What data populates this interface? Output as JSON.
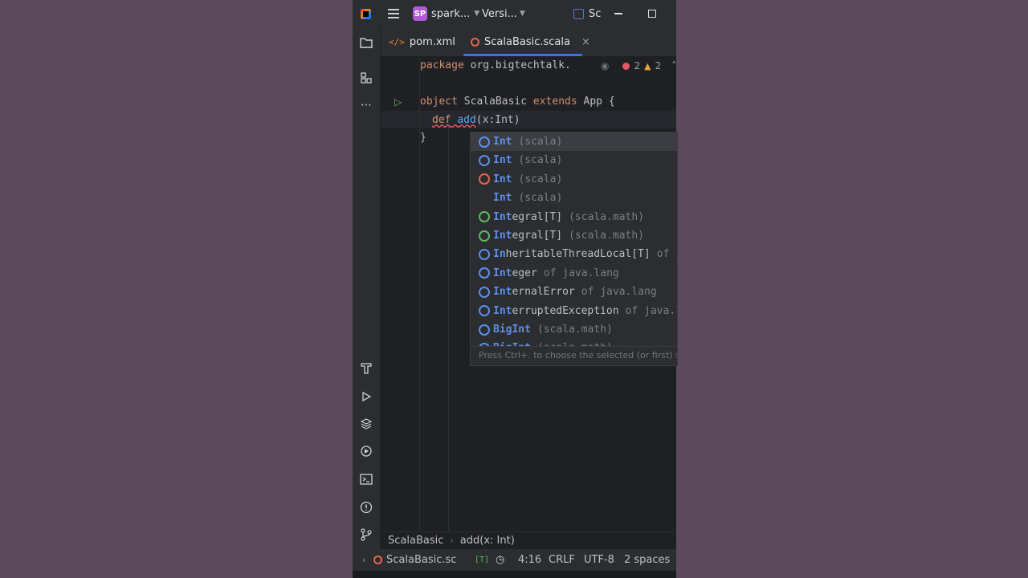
{
  "titlebar": {
    "project_badge": "SP",
    "project_name": "spark...",
    "vcs_label": "Versi...",
    "run_config": "Sc"
  },
  "tabs": [
    {
      "label": "pom.xml",
      "icon": "xml-icon"
    },
    {
      "label": "ScalaBasic.scala",
      "icon": "scala-file-icon",
      "active": true
    }
  ],
  "editor": {
    "lines": {
      "package_kw": "package",
      "package_name": " org.bigtechtalk.",
      "object_kw": "object",
      "object_name": " ScalaBasic ",
      "extends_kw": "extends",
      "object_rest": " App {",
      "def_kw": "def",
      "def_name": "add",
      "def_params": "(x:Int)",
      "close_brace": "}"
    },
    "inspections": {
      "errors": "2",
      "warnings": "2"
    }
  },
  "completion": {
    "items": [
      {
        "icon": "class-object-icon",
        "match": "Int",
        "rest": "",
        "tail": "(scala)",
        "selected": true
      },
      {
        "icon": "class-object-icon",
        "match": "Int",
        "rest": "",
        "tail": "(scala)"
      },
      {
        "icon": "object-icon",
        "match": "Int",
        "rest": "",
        "tail": "(scala)"
      },
      {
        "icon": "none",
        "match": "Int",
        "rest": "",
        "tail": "(scala)"
      },
      {
        "icon": "trait-icon",
        "match": "Int",
        "rest": "egral[T]",
        "tail": "(scala.math)"
      },
      {
        "icon": "trait-icon",
        "match": "Int",
        "rest": "egral[T]",
        "tail": "(scala.math)"
      },
      {
        "icon": "class-icon",
        "match": "In",
        "rest": "heritableThreadLocal[T]",
        "tail": "of j"
      },
      {
        "icon": "class-icon",
        "match": "Int",
        "rest": "eger",
        "tail": "of java.lang"
      },
      {
        "icon": "exception-icon",
        "match": "Int",
        "rest": "ernalError",
        "tail": "of java.lang"
      },
      {
        "icon": "exception-icon",
        "match": "Int",
        "rest": "erruptedException",
        "tail": "of java.l"
      },
      {
        "icon": "class-object-icon",
        "match": "BigInt",
        "rest": "",
        "tail": "(scala.math)"
      },
      {
        "icon": "class-object-icon",
        "match": "BigInt",
        "rest": "",
        "tail": "(scala.math)"
      }
    ],
    "hint": "Press Ctrl+. to choose the selected (or first) su"
  },
  "breadcrumb": {
    "object": "ScalaBasic",
    "member": "add(x: Int)"
  },
  "status": {
    "file": "ScalaBasic.sc",
    "type_mark": "[T]",
    "position": "4:16",
    "line_sep": "CRLF",
    "encoding": "UTF-8",
    "indent": "2 spaces"
  },
  "colors": {
    "accent": "#3574f0",
    "keyword": "#cf8e6d",
    "match": "#5c8fe6"
  }
}
